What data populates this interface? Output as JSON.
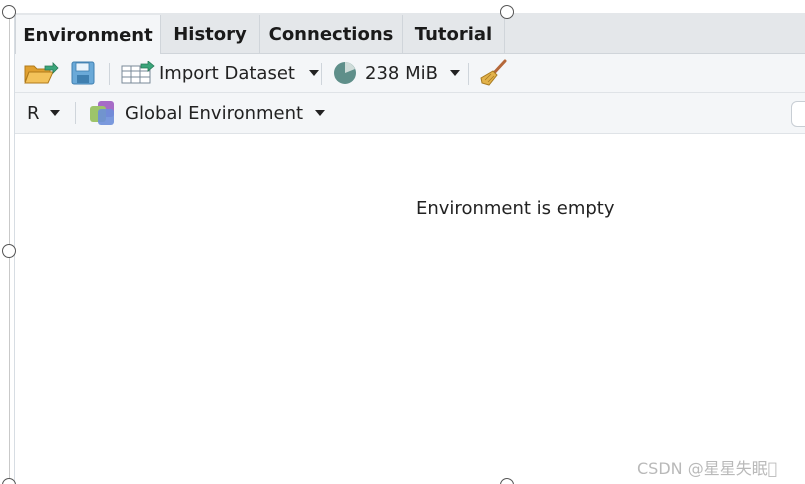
{
  "tabs": [
    {
      "label": "Environment",
      "active": true
    },
    {
      "label": "History",
      "active": false
    },
    {
      "label": "Connections",
      "active": false
    },
    {
      "label": "Tutorial",
      "active": false
    }
  ],
  "toolbar": {
    "open_icon": "folder-open-icon",
    "save_icon": "save-disk-icon",
    "import_label": "Import Dataset",
    "memory_label": "238 MiB",
    "clear_icon": "broom-icon"
  },
  "env_bar": {
    "language": "R",
    "scope_label": "Global Environment"
  },
  "main": {
    "empty_message": "Environment is empty"
  },
  "watermark": "CSDN @星星失眠\u0000"
}
